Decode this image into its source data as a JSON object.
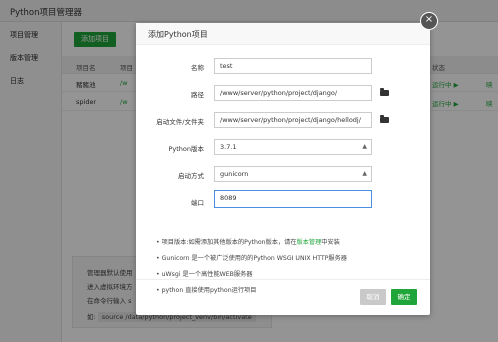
{
  "app": {
    "title": "Python项目管理器"
  },
  "sidebar": {
    "items": [
      {
        "label": "项目管理"
      },
      {
        "label": "版本管理"
      },
      {
        "label": "日志"
      }
    ]
  },
  "main": {
    "add_button": "添加项目",
    "columns": {
      "name": "项目名",
      "path": "项目",
      "status": "状态"
    },
    "rows": [
      {
        "name": "豬豬池",
        "path": "/w",
        "status": "运行中 ▶",
        "extra": "映"
      },
      {
        "name": "spider",
        "path": "/w",
        "status": "运行中 ▶",
        "extra": "映"
      }
    ],
    "hint": {
      "line1": "管理器默认使用",
      "line2": "进入虚拟环境方",
      "line3": "在命令行输入 s",
      "line4_prefix": "如:",
      "line4_code": "source /data/python/project_venv/bin/activate"
    }
  },
  "dialog": {
    "title": "添加Python项目",
    "close_icon": "×",
    "labels": {
      "name": "名称",
      "path": "路径",
      "startup_file": "启动文件/文件夹",
      "python_version": "Python版本",
      "startup_mode": "启动方式",
      "port": "端口"
    },
    "values": {
      "name": "test",
      "path": "/www/server/python/project/django/",
      "startup_file": "/www/server/python/project/django/hellodj/",
      "python_version": "3.7.1",
      "startup_mode": "gunicorn",
      "port": "8089"
    },
    "notes": {
      "n1_prefix": "项目版本:如需添加其他版本的Python版本，请在",
      "n1_link": "版本管理",
      "n1_suffix": "中安装",
      "n2": "Gunicorn 是一个被广泛使用的的Python WSGI UNIX HTTP服务器",
      "n3": "uWsgi 是一个高性能WEB服务器",
      "n4": "python 直接使用python运行项目"
    },
    "cancel": "取消",
    "confirm": "确定"
  },
  "colors": {
    "accent": "#20a53a",
    "focus": "#4a90e2",
    "overlay": "rgba(0,0,0,0.42)"
  },
  "icons": {
    "close": "close-icon",
    "folder": "folder-icon",
    "select": "chevron-down-icon"
  }
}
